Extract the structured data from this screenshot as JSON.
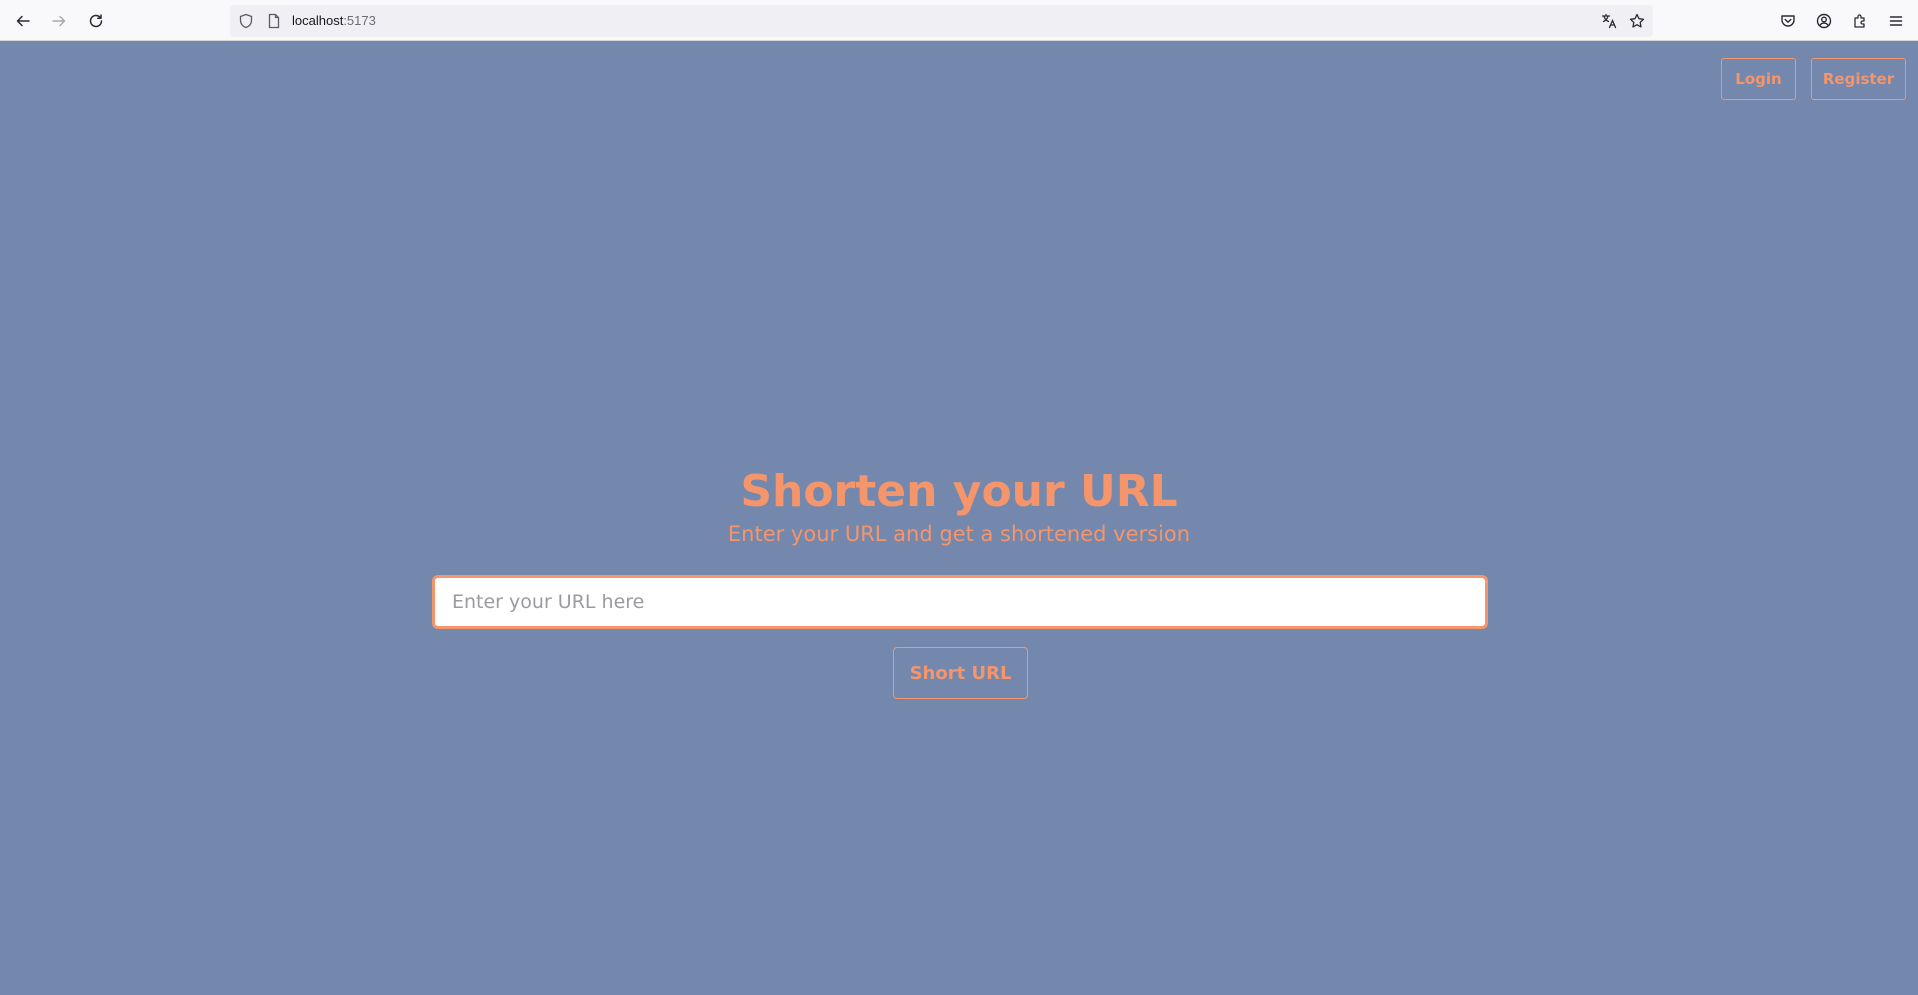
{
  "browser": {
    "url_host": "localhost",
    "url_port": ":5173",
    "icons": {
      "back": "back-arrow-icon",
      "forward": "forward-arrow-icon",
      "reload": "reload-icon",
      "shield": "tracking-protection-icon",
      "page": "page-info-icon",
      "translate": "translate-icon",
      "bookmark": "bookmark-star-icon",
      "pocket": "pocket-icon",
      "account": "account-icon",
      "extensions": "extensions-icon",
      "menu": "hamburger-menu-icon"
    }
  },
  "header": {
    "login_label": "Login",
    "register_label": "Register"
  },
  "hero": {
    "title": "Shorten your URL",
    "subtitle": "Enter your URL and get a shortened version"
  },
  "form": {
    "url_input_value": "",
    "url_input_placeholder": "Enter your URL here",
    "submit_label": "Short URL"
  },
  "colors": {
    "page_background": "#7488ae",
    "accent": "#f4956b",
    "input_background": "#ffffff"
  }
}
